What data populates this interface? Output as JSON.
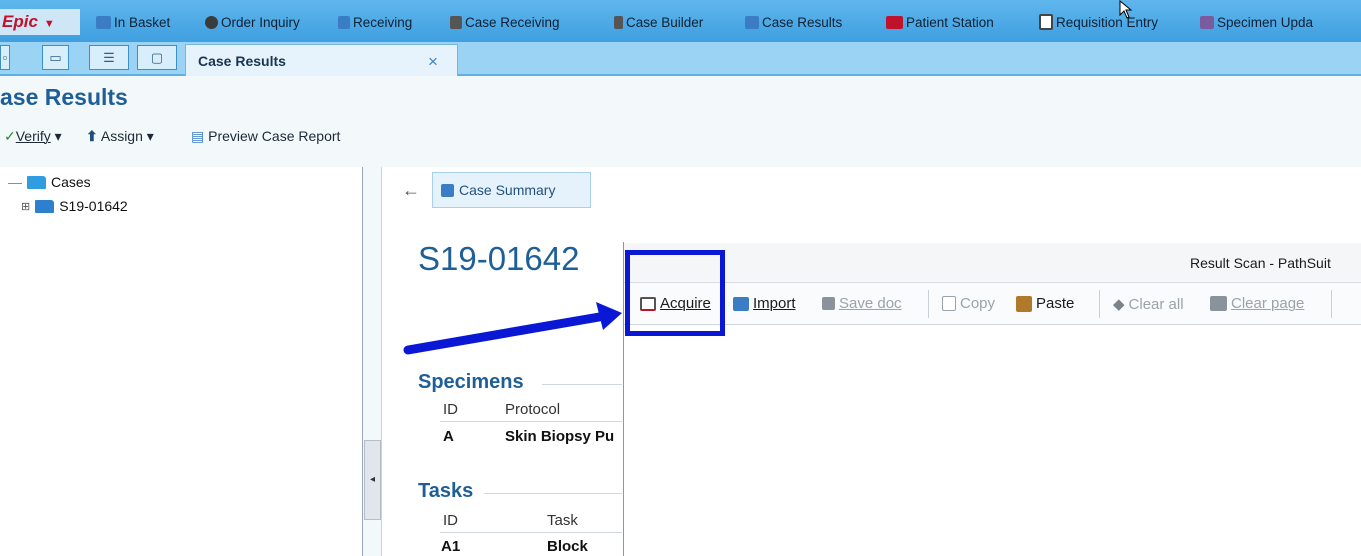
{
  "app": {
    "logo_text": "Epic",
    "logo_caret": "▼"
  },
  "toolbar": [
    {
      "label": "In Basket",
      "icon": "inbox-icon",
      "color": "#3a7dc4"
    },
    {
      "label": "Order Inquiry",
      "icon": "magnifier-icon",
      "color": "#3b3b3b"
    },
    {
      "label": "Receiving",
      "icon": "receiving-icon",
      "color": "#3a7dc4"
    },
    {
      "label": "Case Receiving",
      "icon": "case-receiving-icon",
      "color": "#555555"
    },
    {
      "label": "Case Builder",
      "icon": "case-builder-icon",
      "color": "#555555"
    },
    {
      "label": "Case Results",
      "icon": "case-results-icon",
      "color": "#3a7dc4"
    },
    {
      "label": "Patient Station",
      "icon": "patient-station-icon",
      "color": "#c0122b"
    },
    {
      "label": "Requisition Entry",
      "icon": "clipboard-icon",
      "color": "#555555"
    },
    {
      "label": "Specimen Upda",
      "icon": "specimen-icon",
      "color": "#7a5c9e"
    }
  ],
  "tabbar": {
    "icon_buttons": [
      "window-icon",
      "inbox-icon",
      "list-icon",
      "chat-icon"
    ],
    "active_tab": "Case Results",
    "close_glyph": "×"
  },
  "page": {
    "title": "ase Results",
    "actions": {
      "verify": "Verify",
      "assign": "Assign",
      "preview": "Preview Case Report",
      "dropdown": "▾"
    }
  },
  "tree": {
    "root": "Cases",
    "child": "S19-01642"
  },
  "summary": {
    "back_glyph": "←",
    "case_summary": "Case Summary",
    "case_number": "S19-01642",
    "specimens": {
      "heading": "Specimens",
      "col_id": "ID",
      "col_protocol": "Protocol",
      "row_id": "A",
      "row_protocol": "Skin Biopsy Pu"
    },
    "tasks": {
      "heading": "Tasks",
      "col_id": "ID",
      "col_task": "Task",
      "row_id": "A1",
      "row_task": "Block"
    }
  },
  "dialog": {
    "title": "Result Scan - PathSuit",
    "buttons": {
      "acquire": "Acquire",
      "import": "Import",
      "save_doc": "Save doc",
      "copy": "Copy",
      "paste": "Paste",
      "clear_all": "Clear all",
      "clear_page": "Clear page"
    }
  },
  "colors": {
    "toolbar_blue": "#4aa9e6",
    "heading_blue": "#1f5f97",
    "annotation_blue": "#0a18d6"
  }
}
